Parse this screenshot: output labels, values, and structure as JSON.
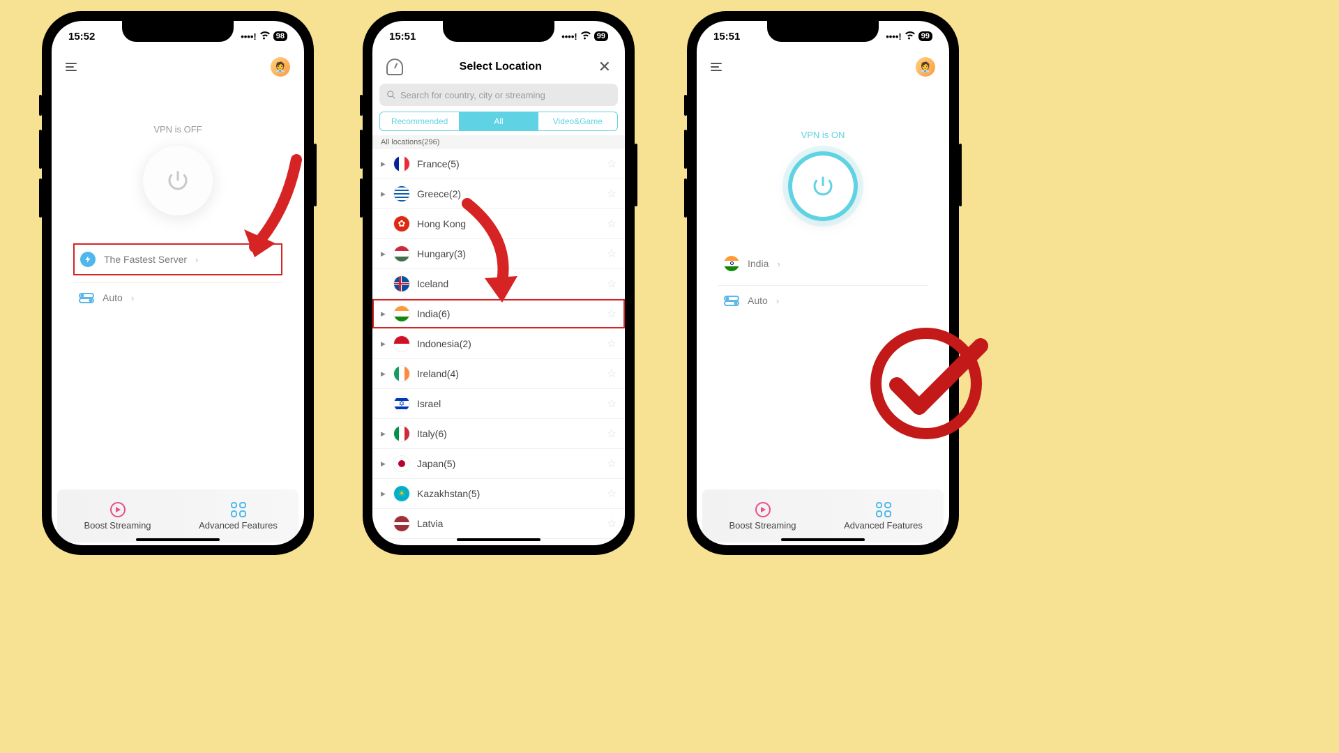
{
  "colors": {
    "accent": "#5fd3e3",
    "highlight": "#d62424"
  },
  "phone1": {
    "time": "15:52",
    "battery": "98",
    "status_text": "VPN is OFF",
    "server_row": "The Fastest Server",
    "auto_row": "Auto",
    "boost": "Boost Streaming",
    "advanced": "Advanced Features"
  },
  "phone2": {
    "time": "15:51",
    "battery": "99",
    "title": "Select Location",
    "search_placeholder": "Search for country, city or streaming",
    "tabs": {
      "rec": "Recommended",
      "all": "All",
      "vg": "Video&Game"
    },
    "section": "All locations(296)",
    "locations": [
      {
        "name": "France(5)",
        "expandable": true,
        "flag": "france"
      },
      {
        "name": "Greece(2)",
        "expandable": true,
        "flag": "greece"
      },
      {
        "name": "Hong Kong",
        "expandable": false,
        "flag": "hongkong"
      },
      {
        "name": "Hungary(3)",
        "expandable": true,
        "flag": "hungary"
      },
      {
        "name": "Iceland",
        "expandable": false,
        "flag": "iceland"
      },
      {
        "name": "India(6)",
        "expandable": true,
        "flag": "india",
        "highlighted": true
      },
      {
        "name": "Indonesia(2)",
        "expandable": true,
        "flag": "indonesia"
      },
      {
        "name": "Ireland(4)",
        "expandable": true,
        "flag": "ireland"
      },
      {
        "name": "Israel",
        "expandable": false,
        "flag": "israel"
      },
      {
        "name": "Italy(6)",
        "expandable": true,
        "flag": "italy"
      },
      {
        "name": "Japan(5)",
        "expandable": true,
        "flag": "japan"
      },
      {
        "name": "Kazakhstan(5)",
        "expandable": true,
        "flag": "kazakhstan"
      },
      {
        "name": "Latvia",
        "expandable": false,
        "flag": "latvia"
      }
    ]
  },
  "phone3": {
    "time": "15:51",
    "battery": "99",
    "status_text": "VPN is ON",
    "server_row": "India",
    "auto_row": "Auto",
    "boost": "Boost Streaming",
    "advanced": "Advanced Features"
  }
}
